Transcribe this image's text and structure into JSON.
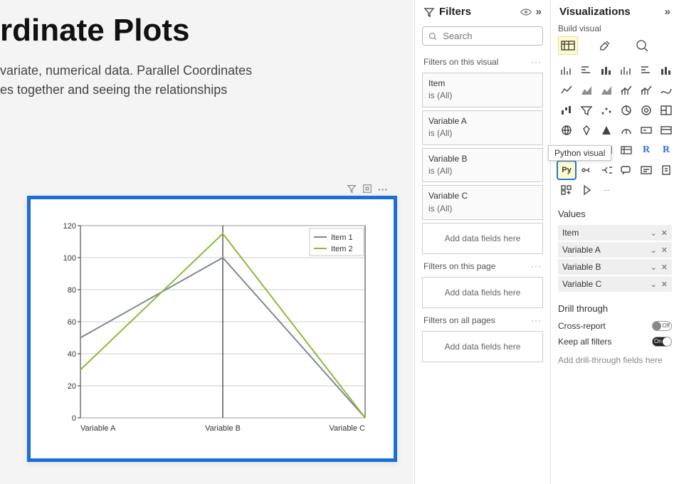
{
  "page": {
    "title": "rdinate Plots",
    "desc_line1": "variate, numerical data. Parallel Coordinates",
    "desc_line2": "es together and seeing the relationships"
  },
  "chart_toolbar": {
    "filter_icon": "filter-icon",
    "focus_icon": "focus-icon",
    "more_icon": "more-icon"
  },
  "chart_data": {
    "type": "line",
    "categories": [
      "Variable A",
      "Variable B",
      "Variable C"
    ],
    "series": [
      {
        "name": "Item 1",
        "values": [
          50,
          100,
          0
        ],
        "color": "#7f8894"
      },
      {
        "name": "Item 2",
        "values": [
          30,
          115,
          0
        ],
        "color": "#8fb83a"
      }
    ],
    "ylim": [
      0,
      120
    ],
    "yticks": [
      0,
      20,
      40,
      60,
      80,
      100,
      120
    ],
    "xlabel": "",
    "ylabel": "",
    "legend_position": "upper-right",
    "grid": true
  },
  "filters": {
    "title": "Filters",
    "search_placeholder": "Search",
    "sections": {
      "visual": {
        "label": "Filters on this visual",
        "items": [
          {
            "name": "Item",
            "value": "is (All)"
          },
          {
            "name": "Variable A",
            "value": "is (All)"
          },
          {
            "name": "Variable B",
            "value": "is (All)"
          },
          {
            "name": "Variable C",
            "value": "is (All)"
          }
        ],
        "drop": "Add data fields here"
      },
      "page": {
        "label": "Filters on this page",
        "drop": "Add data fields here"
      },
      "all": {
        "label": "Filters on all pages",
        "drop": "Add data fields here"
      }
    }
  },
  "viz": {
    "title": "Visualizations",
    "subtitle": "Build visual",
    "tooltip": "Python visual",
    "values_label": "Values",
    "values": [
      "Item",
      "Variable A",
      "Variable B",
      "Variable C"
    ],
    "drill": {
      "title": "Drill through",
      "cross": {
        "label": "Cross-report",
        "state": "Off"
      },
      "keep": {
        "label": "Keep all filters",
        "state": "On"
      },
      "drop": "Add drill-through fields here"
    }
  }
}
